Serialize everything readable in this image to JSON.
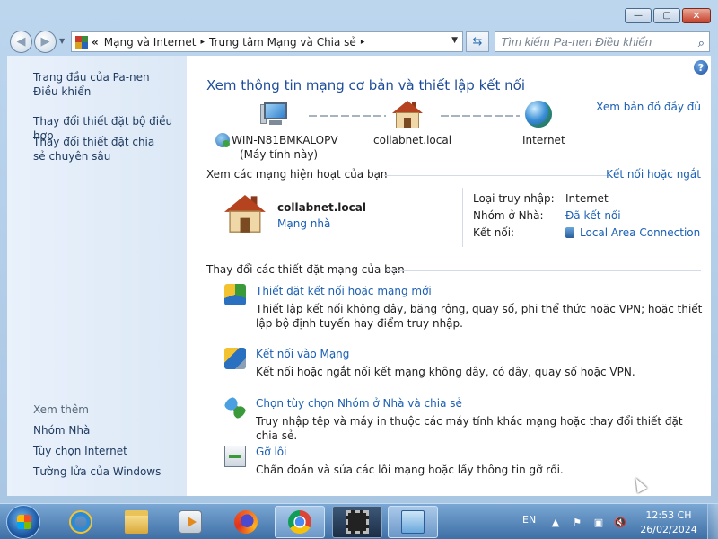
{
  "window": {
    "minimize_label": "—",
    "maximize_label": "▢",
    "close_label": "✕"
  },
  "nav": {
    "breadcrumb_prefix": "«",
    "breadcrumb": [
      "Mạng và Internet",
      "Trung tâm Mạng và Chia sẻ"
    ],
    "breadcrumb_sep": "▸",
    "search_placeholder": "Tìm kiếm Pa-nen Điều khiển"
  },
  "sidebar": {
    "items": [
      {
        "label": "Trang đầu của Pa-nen Điều khiển"
      },
      {
        "label": "Thay đổi thiết đặt bộ điều hợp"
      },
      {
        "label": "Thay đổi thiết đặt chia sẻ chuyên sâu"
      }
    ],
    "see_also_label": "Xem thêm",
    "see_also": [
      {
        "label": "Nhóm Nhà"
      },
      {
        "label": "Tùy chọn Internet"
      },
      {
        "label": "Tường lửa của Windows"
      }
    ]
  },
  "main": {
    "title": "Xem thông tin mạng cơ bản và thiết lập kết nối",
    "full_map_link": "Xem bản đồ đầy đủ",
    "map": {
      "computer_name": "WIN-N81BMKALOPV",
      "computer_sub": "(Máy tính này)",
      "network_name": "collabnet.local",
      "internet_label": "Internet"
    },
    "active_header": "Xem các mạng hiện hoạt của bạn",
    "connect_disconnect_link": "Kết nối hoặc ngắt",
    "active_network": {
      "name": "collabnet.local",
      "type_link": "Mạng nhà",
      "access_type_label": "Loại truy nhập:",
      "access_type_value": "Internet",
      "homegroup_label": "Nhóm ở Nhà:",
      "homegroup_value": "Đã kết nối",
      "connections_label": "Kết nối:",
      "connections_value": "Local Area Connection"
    },
    "change_header": "Thay đổi các thiết đặt mạng của bạn",
    "tasks": [
      {
        "title": "Thiết đặt kết nối hoặc mạng mới",
        "desc": "Thiết lập kết nối không dây, băng rộng, quay số, phi thể thức hoặc VPN; hoặc thiết lập bộ định tuyến hay điểm truy nhập."
      },
      {
        "title": "Kết nối vào Mạng",
        "desc": "Kết nối hoặc ngắt nối kết mạng không dây, có dây, quay số hoặc VPN."
      },
      {
        "title": "Chọn tùy chọn Nhóm ở Nhà và chia sẻ",
        "desc": "Truy nhập tệp và máy in thuộc các máy tính khác mạng hoặc thay đổi thiết đặt chia sẻ."
      },
      {
        "title": "Gỡ lỗi",
        "desc": "Chẩn đoán và sửa các lỗi mạng hoặc lấy thông tin gỡ rối."
      }
    ]
  },
  "taskbar": {
    "language": "EN",
    "time": "12:53 CH",
    "date": "26/02/2024"
  }
}
